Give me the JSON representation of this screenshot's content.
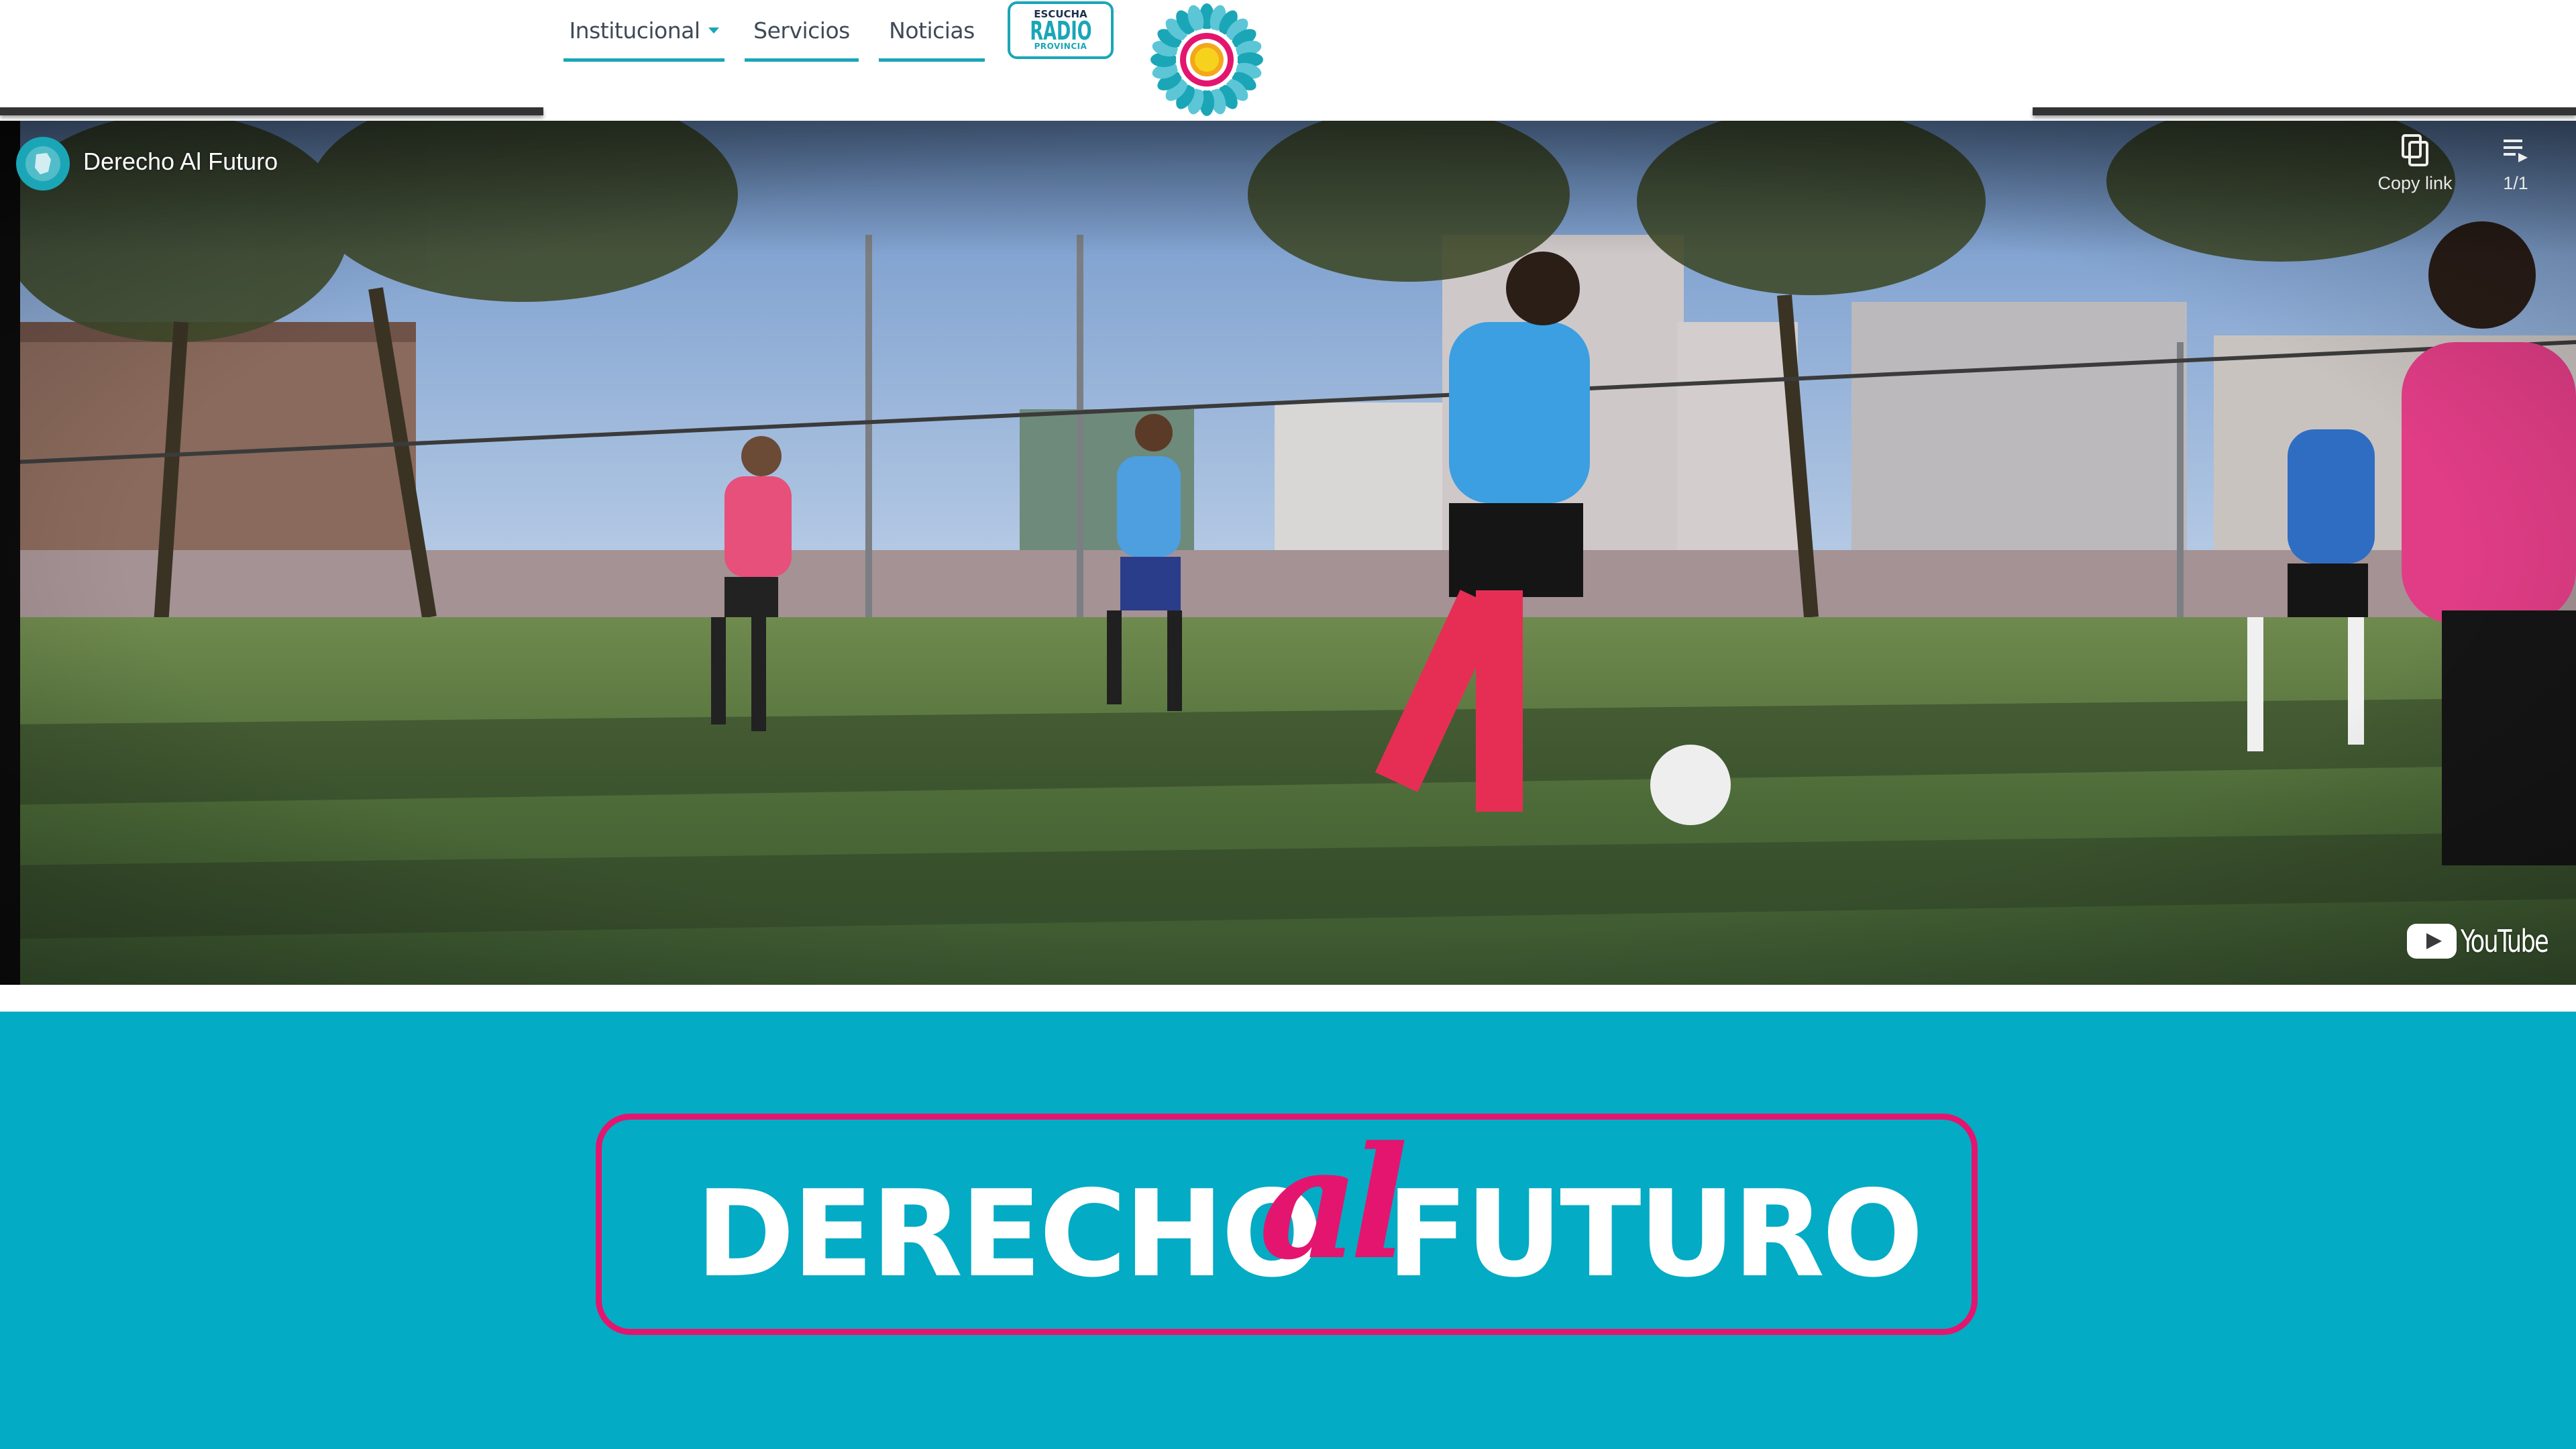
{
  "nav": {
    "items": [
      {
        "label": "Institucional",
        "has_dropdown": true
      },
      {
        "label": "Servicios"
      },
      {
        "label": "Noticias"
      }
    ],
    "radio": {
      "top": "ESCUCHA",
      "main": "RADIO",
      "bottom": "PROVINCIA"
    },
    "emblem_icon": "provincia-sun-emblem-icon"
  },
  "video": {
    "title": "Derecho Al Futuro",
    "channel_icon": "channel-avatar-icon",
    "copy_link_label": "Copy link",
    "playlist_count": "1/1",
    "brand": "YouTube"
  },
  "banner": {
    "word_left": "DERECHO",
    "word_mid": "al",
    "word_right": "FUTURO"
  },
  "colors": {
    "accent": "#1aa6b7",
    "banner_bg": "#04abc4",
    "magenta": "#e4156f",
    "nav_text": "#3f4a56"
  }
}
